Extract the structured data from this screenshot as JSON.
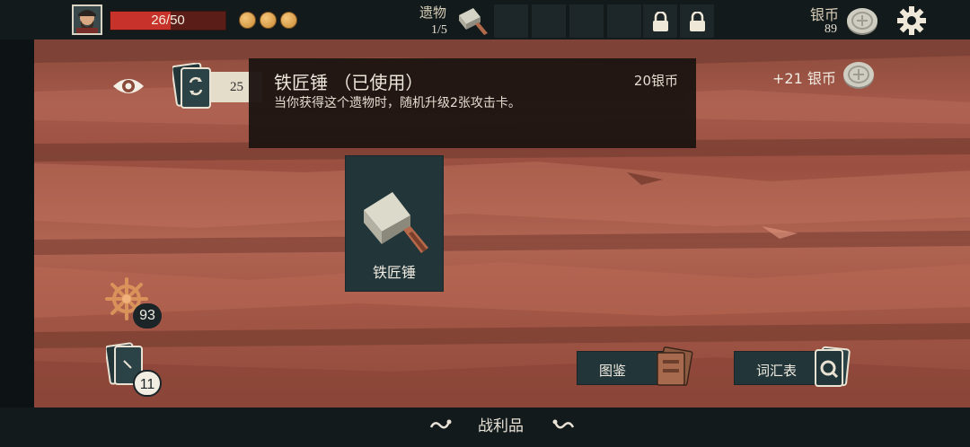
{
  "player": {
    "hp_text": "26/50",
    "hp_current": 26,
    "hp_max": 50,
    "energy_orbs": 3
  },
  "relics": {
    "label": "遗物",
    "count": "1/5",
    "slots": [
      "hammer",
      "empty",
      "empty",
      "empty",
      "empty",
      "locked",
      "locked"
    ]
  },
  "silver": {
    "label": "银币",
    "amount": "89"
  },
  "deck": {
    "count_partial": "25"
  },
  "tooltip": {
    "title": "铁匠锤 （已使用）",
    "price": "20银币",
    "description": "当你获得这个遗物时，随机升级2张攻击卡。"
  },
  "reward": {
    "text": "+21 银币"
  },
  "relic_card": {
    "name": "铁匠锤",
    "icon": "blacksmith-hammer-icon"
  },
  "helm": {
    "count": "93"
  },
  "draw_pile": {
    "count": "11"
  },
  "buttons": {
    "codex": "图鉴",
    "glossary": "词汇表"
  },
  "bottom": {
    "title": "战利品"
  },
  "colors": {
    "hp_red": "#c7332a",
    "panel_teal": "#22363a",
    "wood": "#a5594a",
    "bar_dark": "#121a1c"
  }
}
